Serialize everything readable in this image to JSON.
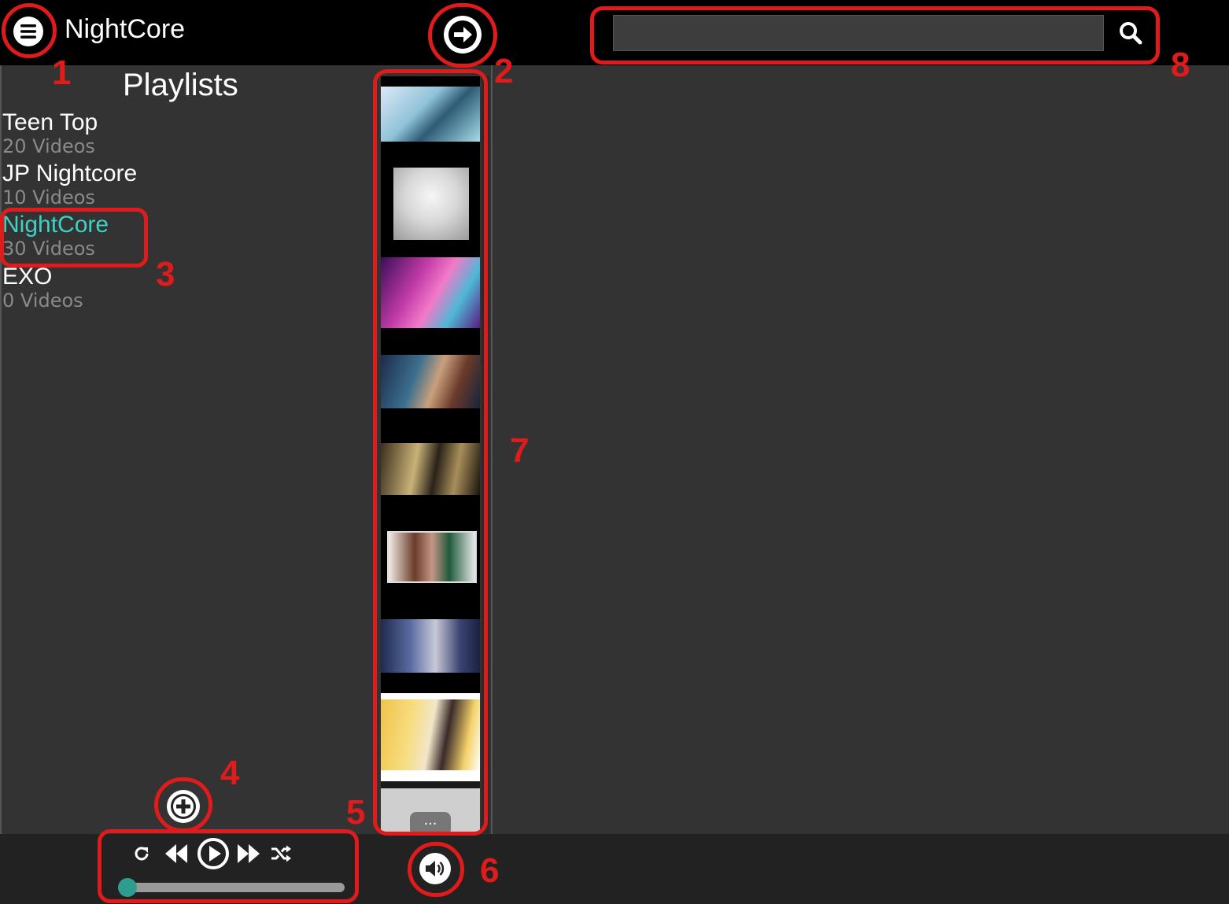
{
  "header": {
    "title": "NightCore",
    "menu_icon": "hamburger-menu-icon",
    "next_icon": "arrow-right-circle-icon",
    "search_placeholder": "",
    "search_icon": "magnifier-icon"
  },
  "sidebar": {
    "title": "Playlists",
    "active_color": "#3fd1c2",
    "items": [
      {
        "name": "Teen Top",
        "count": "20 Videos",
        "active": false
      },
      {
        "name": "JP Nightcore",
        "count": "10 Videos",
        "active": false
      },
      {
        "name": "NightCore",
        "count": "30 Videos",
        "active": true
      },
      {
        "name": "EXO",
        "count": "0 Videos",
        "active": false
      }
    ]
  },
  "video_strip": {
    "thumbnails": [
      "thumb-1",
      "thumb-2",
      "thumb-3",
      "thumb-4",
      "thumb-5",
      "thumb-6",
      "thumb-7",
      "thumb-8"
    ],
    "more_label": "..."
  },
  "player": {
    "add_icon": "plus-circle-icon",
    "repeat_icon": "repeat-icon",
    "prev_icon": "rewind-icon",
    "play_icon": "play-circle-icon",
    "next_icon": "fast-forward-icon",
    "shuffle_icon": "shuffle-icon",
    "volume_icon": "volume-icon",
    "progress_fraction": 0,
    "accent_color": "#2e9d8f"
  },
  "annotations": {
    "color": "#e01b1b",
    "labels": [
      "1",
      "2",
      "3",
      "4",
      "5",
      "6",
      "7",
      "8"
    ]
  }
}
